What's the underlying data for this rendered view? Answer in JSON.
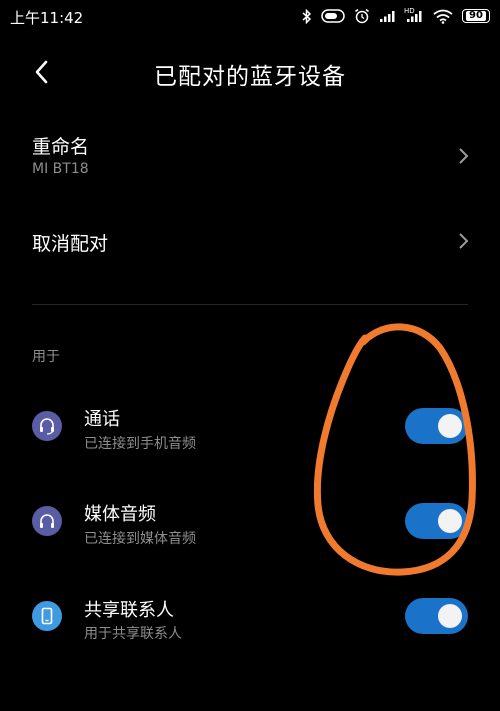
{
  "status_bar": {
    "time": "上午11:42",
    "hd_label": "HD",
    "battery": "90",
    "icons": [
      "bluetooth-icon",
      "data-saver-icon",
      "alarm-icon",
      "signal-icon",
      "signal-hd-icon",
      "wifi-icon",
      "battery-icon"
    ]
  },
  "header": {
    "title": "已配对的蓝牙设备",
    "back_icon": "back-arrow-icon"
  },
  "rename": {
    "title": "重命名",
    "value": "MI BT18"
  },
  "unpair": {
    "title": "取消配对"
  },
  "section": {
    "label": "用于"
  },
  "profiles": [
    {
      "title": "通话",
      "subtitle": "已连接到手机音频",
      "icon": "headset-icon",
      "icon_color": "#5b5ca6",
      "enabled": true
    },
    {
      "title": "媒体音频",
      "subtitle": "已连接到媒体音频",
      "icon": "headphones-icon",
      "icon_color": "#5b5ca6",
      "enabled": true
    },
    {
      "title": "共享联系人",
      "subtitle": "用于共享联系人",
      "icon": "phone-icon",
      "icon_color": "#3f9ae0",
      "enabled": true
    }
  ],
  "colors": {
    "background": "#000000",
    "toggle_on": "#1a73c9",
    "annotation": "#f07a2e",
    "secondary_text": "#8d8d8d"
  }
}
